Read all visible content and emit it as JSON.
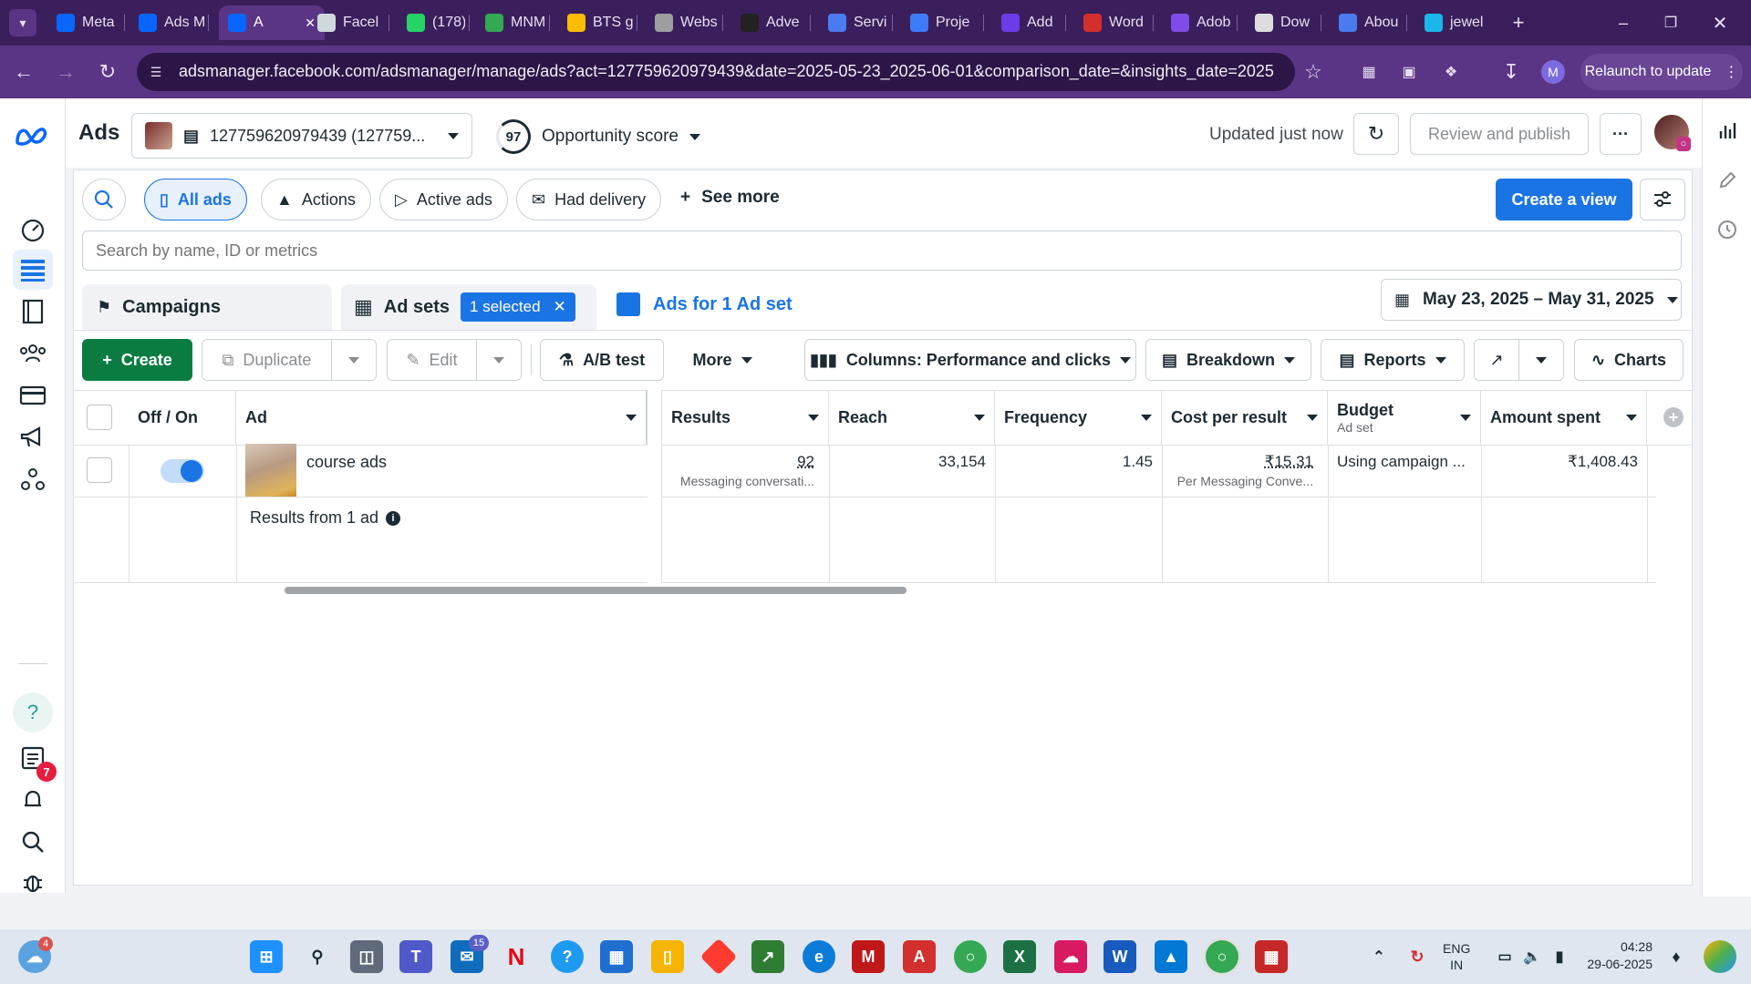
{
  "browser": {
    "tabs": [
      {
        "label": "Meta",
        "icon": "meta-icon",
        "color": "#0866ff"
      },
      {
        "label": "Ads M",
        "icon": "meta-icon",
        "color": "#0866ff"
      },
      {
        "label": "A",
        "icon": "meta-icon",
        "color": "#0866ff",
        "active": true
      },
      {
        "label": "Facel",
        "icon": "document-icon",
        "color": "#cfd8dc"
      },
      {
        "label": "(178)",
        "icon": "whatsapp-icon",
        "color": "#25d366"
      },
      {
        "label": "MNM",
        "icon": "drive-icon",
        "color": "#34a853"
      },
      {
        "label": "BTS g",
        "icon": "drive-icon",
        "color": "#fbbc04"
      },
      {
        "label": "Webs",
        "icon": "globe-icon",
        "color": "#9e9e9e"
      },
      {
        "label": "Adve",
        "icon": "chatgpt-icon",
        "color": "#222222"
      },
      {
        "label": "Servi",
        "icon": "gmail-icon",
        "color": "#4a7cf0"
      },
      {
        "label": "Proje",
        "icon": "canva-icon",
        "color": "#3e7cf7"
      },
      {
        "label": "Add",
        "icon": "heart-icon",
        "color": "#6a3de8"
      },
      {
        "label": "Word",
        "icon": "target-icon",
        "color": "#d32f2f"
      },
      {
        "label": "Adob",
        "icon": "play-icon",
        "color": "#7e4ce8"
      },
      {
        "label": "Dow",
        "icon": "download-icon",
        "color": "#dddddd"
      },
      {
        "label": "Abou",
        "icon": "gmail-icon",
        "color": "#4a7cf0"
      },
      {
        "label": "jewel",
        "icon": "vimeo-icon",
        "color": "#1ab7ea"
      }
    ],
    "url": "adsmanager.facebook.com/adsmanager/manage/ads?act=127759620979439&date=2025-05-23_2025-06-01&comparison_date=&insights_date=2025-05-...",
    "relaunch_label": "Relaunch to update",
    "profile_letter": "M"
  },
  "topbar": {
    "app_title": "Ads",
    "account_name": "127759620979439 (127759...",
    "opportunity_score": "97",
    "opportunity_label": "Opportunity score",
    "updated_status": "Updated just now",
    "review_publish_label": "Review and publish",
    "more_label": "···"
  },
  "filters": {
    "all_ads": "All ads",
    "actions": "Actions",
    "active_ads": "Active ads",
    "had_delivery": "Had delivery",
    "see_more": "See more",
    "create_view": "Create a view"
  },
  "search": {
    "placeholder": "Search by name, ID or metrics"
  },
  "levels": {
    "campaigns": "Campaigns",
    "ad_sets": "Ad sets",
    "selected_badge": "1 selected",
    "ads": "Ads for 1 Ad set",
    "date_range": "May 23, 2025 – May 31, 2025"
  },
  "actions": {
    "create": "Create",
    "duplicate": "Duplicate",
    "edit": "Edit",
    "ab_test": "A/B test",
    "more": "More",
    "columns": "Columns: Performance and clicks",
    "breakdown": "Breakdown",
    "reports": "Reports",
    "charts": "Charts"
  },
  "table": {
    "headers": {
      "off_on": "Off / On",
      "ad": "Ad",
      "results": "Results",
      "reach": "Reach",
      "frequency": "Frequency",
      "cost_per_result": "Cost per result",
      "budget": "Budget",
      "budget_sub": "Ad set",
      "amount_spent": "Amount spent"
    },
    "row": {
      "name": "course ads",
      "toggle_on": true,
      "results": "92",
      "results_sub": "Messaging conversati...",
      "reach": "33,154",
      "frequency": "1.45",
      "cost_per_result": "₹15.31",
      "cost_sub": "Per Messaging Conve...",
      "budget": "Using campaign ...",
      "amount_spent": "₹1,408.43"
    },
    "footer": "Results from 1 ad"
  },
  "leftnav": {
    "notifications_badge": "7"
  },
  "taskbar": {
    "weather_badge": "4",
    "teams_badge": "15",
    "language": "ENG",
    "region": "IN",
    "time": "04:28",
    "date": "29-06-2025"
  }
}
